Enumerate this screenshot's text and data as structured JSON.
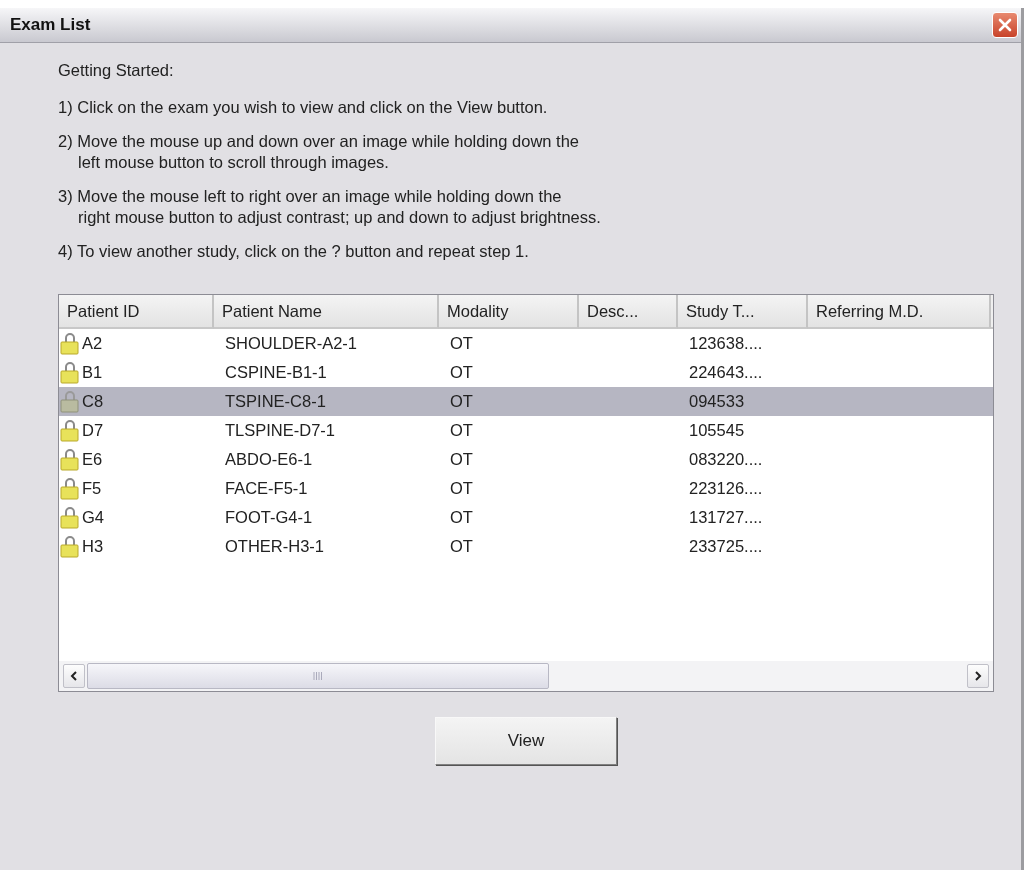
{
  "window": {
    "title": "Exam List"
  },
  "heading": "Getting Started:",
  "steps": [
    {
      "lines": [
        "1) Click on the exam you wish to view and click on the View button."
      ]
    },
    {
      "lines": [
        "2) Move the mouse up and down over an image while holding down the",
        "left mouse button to scroll through images."
      ]
    },
    {
      "lines": [
        "3) Move the mouse left to right over an image while holding down the",
        "right mouse button to adjust contrast; up and down to adjust brightness."
      ]
    },
    {
      "lines": [
        "4) To view another study, click on the ? button and repeat step 1."
      ]
    }
  ],
  "table": {
    "columns": [
      "Patient ID",
      "Patient Name",
      "Modality",
      "Desc...",
      "Study T...",
      "Referring M.D."
    ],
    "rows": [
      {
        "cells": [
          "A2",
          "SHOULDER-A2-1",
          "OT",
          "",
          "123638...."
        ],
        "selected": false
      },
      {
        "cells": [
          "B1",
          "CSPINE-B1-1",
          "OT",
          "",
          "224643...."
        ],
        "selected": false
      },
      {
        "cells": [
          "C8",
          "TSPINE-C8-1",
          "OT",
          "",
          "094533"
        ],
        "selected": true
      },
      {
        "cells": [
          "D7",
          "TLSPINE-D7-1",
          "OT",
          "",
          "105545"
        ],
        "selected": false
      },
      {
        "cells": [
          "E6",
          "ABDO-E6-1",
          "OT",
          "",
          "083220...."
        ],
        "selected": false
      },
      {
        "cells": [
          "F5",
          "FACE-F5-1",
          "OT",
          "",
          "223126...."
        ],
        "selected": false
      },
      {
        "cells": [
          "G4",
          "FOOT-G4-1",
          "OT",
          "",
          "131727...."
        ],
        "selected": false
      },
      {
        "cells": [
          "H3",
          "OTHER-H3-1",
          "OT",
          "",
          "233725...."
        ],
        "selected": false
      }
    ]
  },
  "buttons": [
    "View"
  ]
}
